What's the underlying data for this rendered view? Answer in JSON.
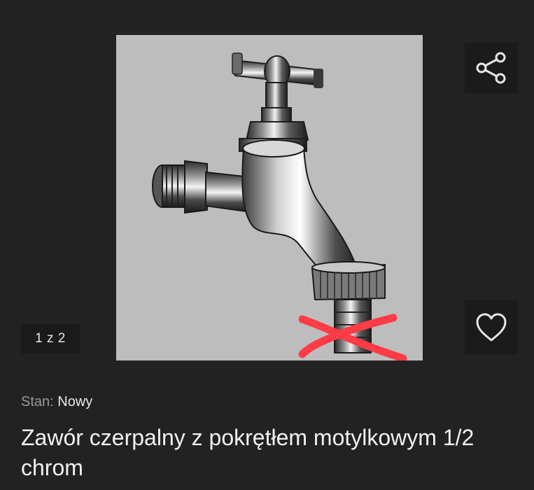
{
  "gallery": {
    "counter": "1 z 2",
    "image_subject": "chrome-bib-tap-with-red-cross-mark"
  },
  "actions": {
    "share_icon": "share-icon",
    "favorite_icon": "heart-icon"
  },
  "listing": {
    "condition_label": "Stan:",
    "condition_value": "Nowy",
    "title": "Zawór czerpalny z pokrętłem motylkowym 1/2 chrom"
  },
  "colors": {
    "background": "#222222",
    "photo_background": "#bdbdbd",
    "cross_mark": "#ff3b46",
    "text_primary": "#f2f2f2",
    "text_secondary": "#9a9a9a"
  }
}
